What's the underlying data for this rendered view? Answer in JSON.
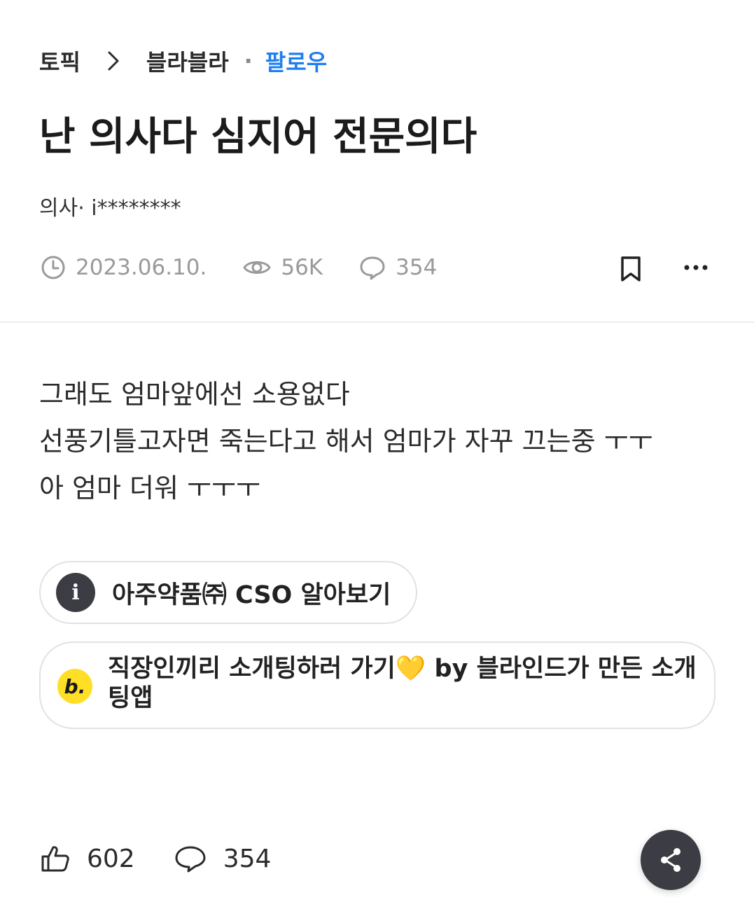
{
  "breadcrumb": {
    "topic": "토픽",
    "board": "블라블라",
    "separator": "·",
    "follow": "팔로우"
  },
  "post": {
    "title": "난 의사다 심지어 전문의다",
    "author": "의사· i********",
    "date": "2023.06.10.",
    "views": "56K",
    "comments": "354",
    "body_lines": [
      "그래도 엄마앞에선 소용없다",
      "선풍기틀고자면 죽는다고 해서 엄마가 자꾸 끄는중 ㅜㅜ",
      "아 엄마 더워 ㅜㅜㅜ"
    ]
  },
  "links": [
    {
      "icon": "info-icon",
      "badge_text": "i",
      "label": "아주약품㈜ CSO 알아보기"
    },
    {
      "icon": "blind-dating-app-icon",
      "badge_text": "b.",
      "label": "직장인끼리 소개팅하러 가기💛 by 블라인드가 만든 소개팅앱"
    }
  ],
  "footer": {
    "likes": "602",
    "comments": "354"
  },
  "colors": {
    "accent": "#1e7ef0",
    "muted": "#9a9a9a",
    "share_bg": "#3c3c44",
    "blind_badge": "#ffdf26"
  }
}
